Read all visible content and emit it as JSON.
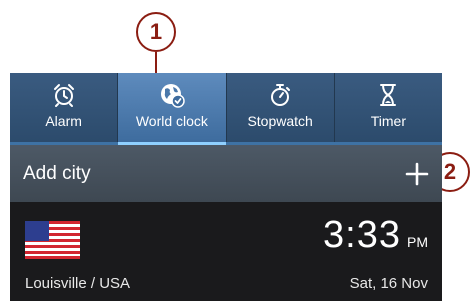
{
  "callouts": [
    {
      "label": "1"
    },
    {
      "label": "2"
    }
  ],
  "tabs": [
    {
      "label": "Alarm",
      "icon": "alarm-clock-icon"
    },
    {
      "label": "World clock",
      "icon": "world-clock-icon",
      "active": true
    },
    {
      "label": "Stopwatch",
      "icon": "stopwatch-icon"
    },
    {
      "label": "Timer",
      "icon": "hourglass-icon"
    }
  ],
  "add_city": {
    "label": "Add city",
    "icon": "plus-icon"
  },
  "city": {
    "name": "Louisville / USA",
    "time": "3:33",
    "ampm": "PM",
    "date": "Sat, 16 Nov",
    "flag_icon": "usa-flag-icon"
  },
  "colors": {
    "accent": "#8b1d12",
    "tab_bg": "#2f5072",
    "tab_active": "#5e8bbd",
    "background": "#1f1f21"
  }
}
